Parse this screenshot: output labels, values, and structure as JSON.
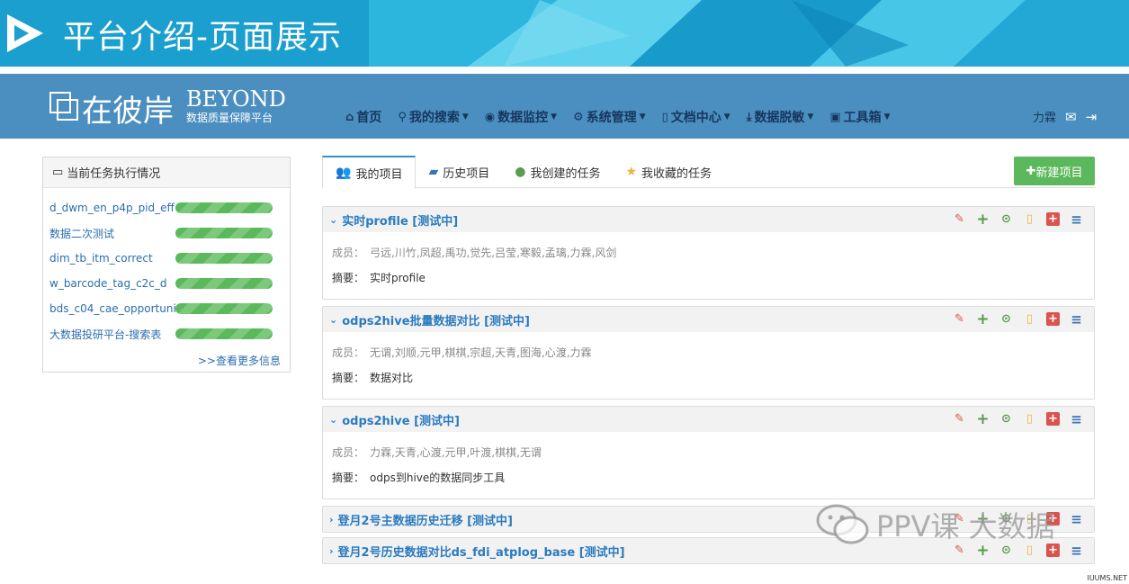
{
  "banner": {
    "title": "平台介绍-页面展示"
  },
  "brand": {
    "name_cn": "在彼岸",
    "name_en": "BEYOND",
    "subtitle": "数据质量保障平台"
  },
  "nav": {
    "items": [
      {
        "label": "首页",
        "icon": "home-icon",
        "has_dropdown": false
      },
      {
        "label": "我的搜索",
        "icon": "search-icon",
        "has_dropdown": true
      },
      {
        "label": "数据监控",
        "icon": "eye-icon",
        "has_dropdown": true
      },
      {
        "label": "系统管理",
        "icon": "gear-icon",
        "has_dropdown": true
      },
      {
        "label": "文档中心",
        "icon": "file-icon",
        "has_dropdown": true
      },
      {
        "label": "数据脱敏",
        "icon": "download-icon",
        "has_dropdown": true
      },
      {
        "label": "工具箱",
        "icon": "toolbox-icon",
        "has_dropdown": true
      }
    ],
    "user": "力霖"
  },
  "task_panel": {
    "title": "当前任务执行情况",
    "tasks": [
      {
        "name": "d_dwm_en_p4p_pid_eff",
        "progress": 1.0
      },
      {
        "name": "数据二次测试",
        "progress": 1.0
      },
      {
        "name": "dim_tb_itm_correct",
        "progress": 1.0
      },
      {
        "name": "w_barcode_tag_c2c_d",
        "progress": 1.0
      },
      {
        "name": "bds_c04_cae_opportuni",
        "progress": 1.0
      },
      {
        "name": "大数据投研平台-搜索表",
        "progress": 1.0
      }
    ],
    "more": ">>查看更多信息"
  },
  "tabs": [
    {
      "label": "我的项目",
      "icon": "users-icon",
      "active": true
    },
    {
      "label": "历史项目",
      "icon": "folder-icon",
      "active": false
    },
    {
      "label": "我创建的任务",
      "icon": "user-icon",
      "active": false
    },
    {
      "label": "我收藏的任务",
      "icon": "star-icon",
      "active": false
    }
  ],
  "new_project": "新建项目",
  "projects": [
    {
      "title": "实时profile  [测试中]",
      "expanded": true,
      "members_label": "成员：",
      "members": "弓远,川竹,凤超,禹功,觉先,吕莹,寒毅,孟璃,力霖,风剑",
      "summary_label": "摘要：",
      "summary": "实时profile"
    },
    {
      "title": "odps2hive批量数据对比  [测试中]",
      "expanded": true,
      "members_label": "成员：",
      "members": "无谓,刘顺,元甲,棋棋,宗超,天青,图海,心渡,力霖",
      "summary_label": "摘要：",
      "summary": "数据对比"
    },
    {
      "title": "odps2hive  [测试中]",
      "expanded": true,
      "members_label": "成员：",
      "members": "力霖,天青,心渡,元甲,叶渡,棋棋,无谓",
      "summary_label": "摘要：",
      "summary": "odps到hive的数据同步工具"
    },
    {
      "title": "登月2号主数据历史迁移 [测试中]",
      "expanded": false
    },
    {
      "title": "登月2号历史数据对比ds_fdi_atplog_base [测试中]",
      "expanded": false
    }
  ],
  "watermark": "PPV课 大数据",
  "corner_tag": "IUUMS.NET",
  "colors": {
    "navbar": "#4a8fc0",
    "banner": "#1a9fce",
    "accent_blue": "#2a7bbf",
    "success": "#5cb85c",
    "danger": "#d9534f"
  }
}
